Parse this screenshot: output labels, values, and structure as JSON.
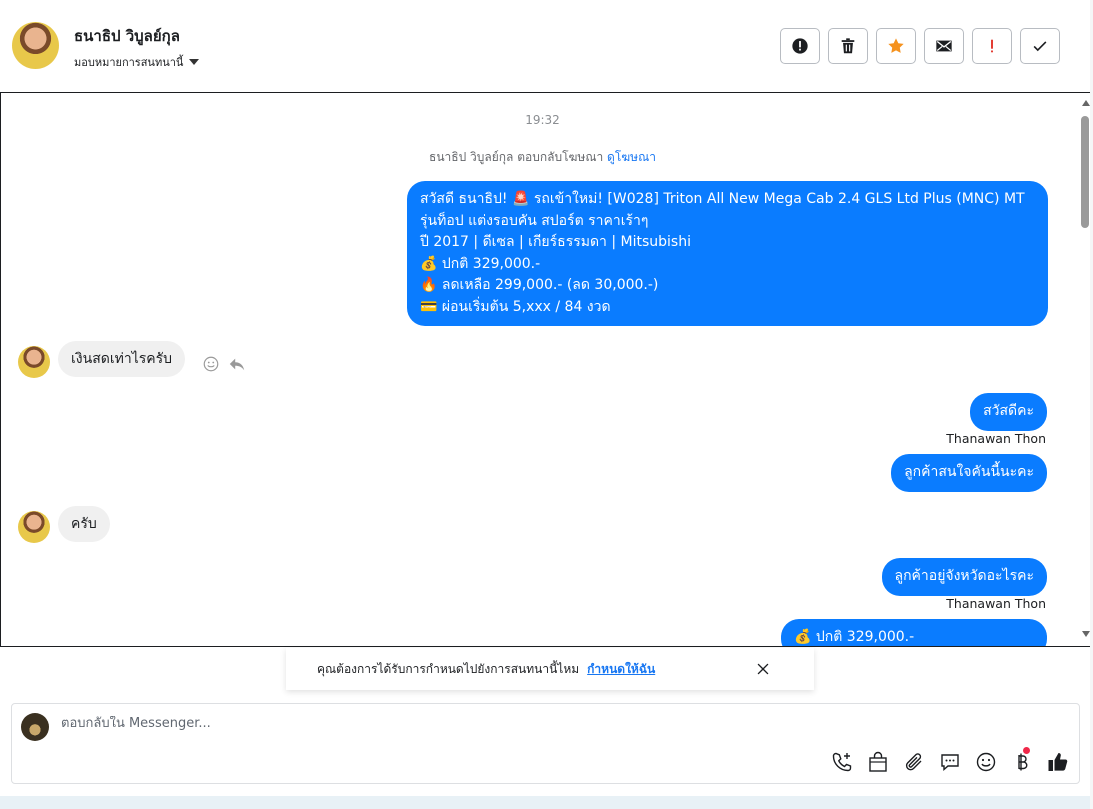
{
  "header": {
    "contact_name": "ธนาธิป วิบูลย์กุล",
    "assign_label": "มอบหมายการสนทนานี้"
  },
  "actions": [
    {
      "name": "report-button",
      "icon": "exclamation-circle-icon"
    },
    {
      "name": "delete-button",
      "icon": "trash-icon"
    },
    {
      "name": "star-button",
      "icon": "star-icon",
      "color": "#f5921e"
    },
    {
      "name": "mail-button",
      "icon": "envelope-icon"
    },
    {
      "name": "important-button",
      "icon": "exclamation-icon",
      "color": "#e0281e"
    },
    {
      "name": "done-button",
      "icon": "check-icon"
    }
  ],
  "chat": {
    "time": "19:32",
    "system_text": "ธนาธิป วิบูลย์กุล ตอบกลับโฆษณา",
    "system_link": "ดูโฆษณา",
    "ad_message": [
      "สวัสดี ธนาธิป! 🚨 รถเข้าใหม่! [W028] Triton All New Mega Cab 2.4 GLS Ltd Plus (MNC) MT",
      "รุ่นท็อป แต่งรอบคัน สปอร์ต ราคาเร้าๆ",
      "ปี 2017 | ดีเซล | เกียร์ธรรมดา | Mitsubishi",
      "💰 ปกติ 329,000.-",
      "🔥 ลดเหลือ 299,000.- (ลด 30,000.-)",
      "💳 ผ่อนเริ่มต้น 5,xxx / 84 งวด"
    ],
    "in_msg_1": "เงินสดเท่าไรครับ",
    "out_msg_1": "สวัสดีคะ",
    "sender_1": "Thanawan Thon",
    "out_msg_2": "ลูกค้าสนใจคันนี้นะคะ",
    "in_msg_2": "ครับ",
    "out_msg_3": "ลูกค้าอยู่จังหวัดอะไรคะ",
    "sender_2": "Thanawan Thon",
    "out_msg_4": "💰 ปกติ 329,000.-"
  },
  "toast": {
    "text": "คุณต้องการได้รับการกำหนดไปยังการสนทนานี้ไหม",
    "link": "กำหนดให้ฉัน"
  },
  "composer": {
    "placeholder": "ตอบกลับใน Messenger..."
  },
  "composer_tools": [
    "call-add-icon",
    "shopping-bag-icon",
    "paperclip-icon",
    "chat-bubble-icon",
    "smiley-icon",
    "baht-icon",
    "thumbs-up-icon"
  ],
  "colors": {
    "accent": "#0a7cff",
    "star": "#f5921e",
    "alert": "#e0281e",
    "link": "#1877f2"
  }
}
